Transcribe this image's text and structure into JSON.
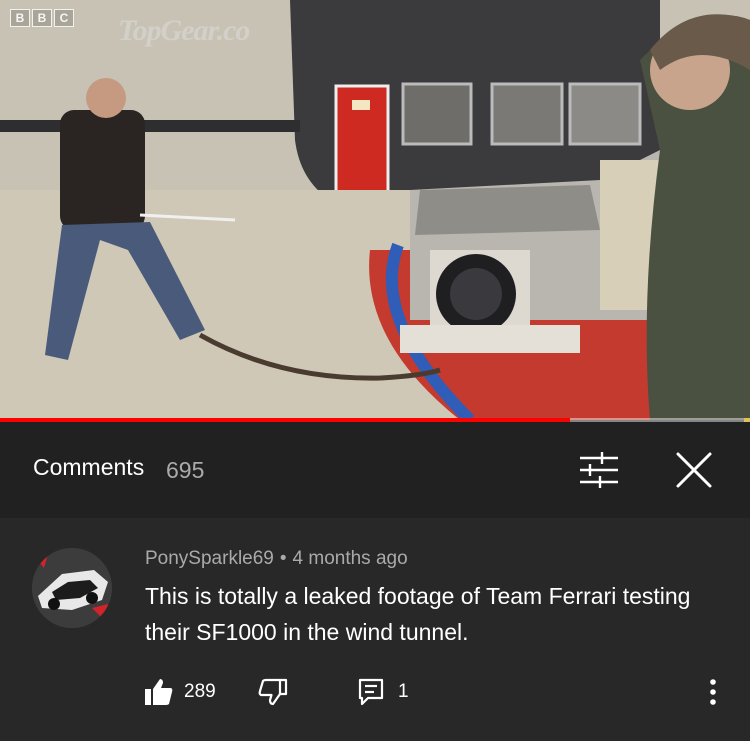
{
  "video": {
    "channel_badge": [
      "B",
      "B",
      "C"
    ],
    "watermark": "TopGear.co",
    "progress_percent": 76
  },
  "comments_header": {
    "title": "Comments",
    "count": "695",
    "sort_icon": "sort-sliders-icon",
    "close_icon": "close-icon"
  },
  "comment": {
    "author": "PonySparkle69",
    "separator": "•",
    "time": "4 months ago",
    "text": "This is totally a leaked footage of Team Ferrari testing their SF1000 in the wind tunnel.",
    "likes": "289",
    "replies": "1"
  },
  "colors": {
    "background": "#212121",
    "comment_background": "#282828",
    "progress": "#ff0000",
    "secondary_text": "#aaaaaa"
  }
}
